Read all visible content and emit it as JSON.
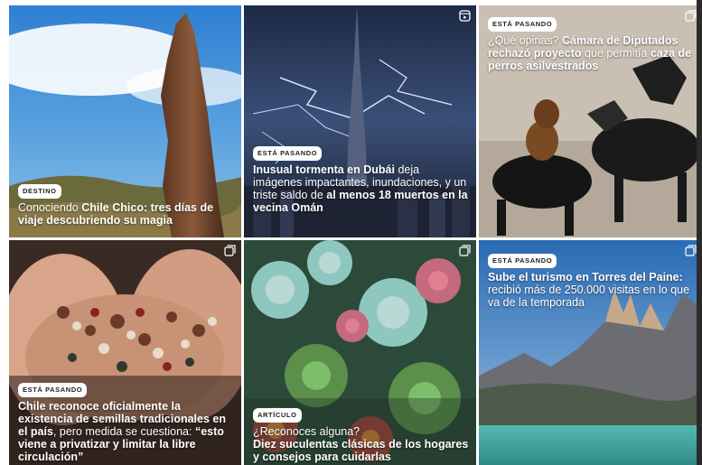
{
  "posts": [
    {
      "badge": "DESTINO",
      "text_a": "Conociendo ",
      "text_b": "Chile Chico:",
      "text_c": " tres días de viaje descubriendo su magia",
      "icon": "none"
    },
    {
      "badge": "ESTÁ PASANDO",
      "text_a": "Inusual tormenta en Dubái",
      "text_b": " deja imágenes impactantes, inundaciones, y un triste saldo de ",
      "text_c": "al menos 18 muertos en la vecina Omán",
      "icon": "reel-icon"
    },
    {
      "badge": "ESTÁ PASANDO",
      "text_a": "¿Qué opinas? ",
      "text_b": "Cámara de Diputados rechazó proyecto",
      "text_c": " que permitía ",
      "text_d": "caza de perros asilvestrados",
      "icon": "carousel-icon"
    },
    {
      "badge": "ESTÁ PASANDO",
      "text_a": "Chile reconoce oficialmente la existencia de semillas tradicionales en el país",
      "text_b": ", pero medida se cuestiona: ",
      "text_c": "“esto viene a privatizar y limitar la libre circulación”",
      "icon": "carousel-icon"
    },
    {
      "badge": "ARTÍCULO",
      "text_a": "¿Reconoces alguna?",
      "text_b": "Diez suculentas clásicas de los hogares y consejos para cuidarlas",
      "icon": "carousel-icon"
    },
    {
      "badge": "ESTÁ PASANDO",
      "text_a": "Sube el turismo en Torres del Paine:",
      "text_b": " recibió más de 250.000 visitas en lo que va de la temporada",
      "icon": "carousel-icon"
    }
  ]
}
